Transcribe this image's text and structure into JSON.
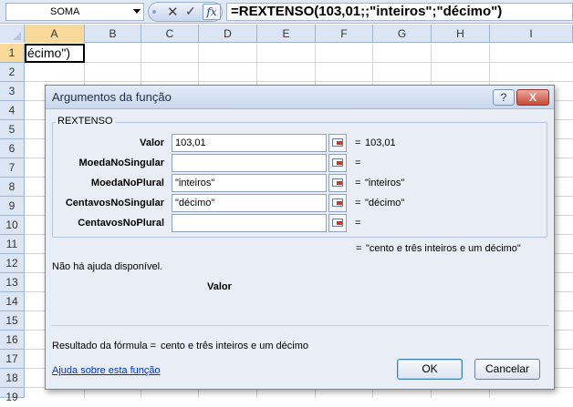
{
  "formula_bar": {
    "name_box": "SOMA",
    "cancel_symbol": "✕",
    "enter_symbol": "✓",
    "insert_function_symbol": "fx",
    "formula": "=REXTENSO(103,01;;\"inteiros\";\"décimo\")"
  },
  "grid": {
    "columns": [
      "A",
      "B",
      "C",
      "D",
      "E",
      "F",
      "G",
      "H",
      "I"
    ],
    "rows": [
      "1",
      "2",
      "3",
      "4",
      "5",
      "6",
      "7",
      "8",
      "9",
      "10",
      "11",
      "12",
      "13",
      "14",
      "15",
      "16",
      "17",
      "18",
      "19"
    ],
    "active_column": "A",
    "active_row": "1",
    "active_cell_text": "écimo\")"
  },
  "dialog": {
    "title": "Argumentos da função",
    "help_symbol": "?",
    "close_symbol": "X",
    "function_name": "REXTENSO",
    "arguments": [
      {
        "name": "Valor",
        "input": "103,01",
        "result": "103,01"
      },
      {
        "name": "MoedaNoSingular",
        "input": "",
        "result": ""
      },
      {
        "name": "MoedaNoPlural",
        "input": "\"inteiros\"",
        "result": "\"inteiros\""
      },
      {
        "name": "CentavosNoSingular",
        "input": "\"décimo\"",
        "result": "\"décimo\""
      },
      {
        "name": "CentavosNoPlural",
        "input": "",
        "result": ""
      }
    ],
    "equals_sign": "=",
    "function_result": "\"cento e três inteiros e um décimo\"",
    "no_help_text": "Não há ajuda disponível.",
    "current_argument": "Valor",
    "formula_result_label": "Resultado da fórmula =",
    "formula_result_value": "cento e três inteiros e um décimo",
    "help_link": "Ajuda sobre esta função",
    "ok_label": "OK",
    "cancel_label": "Cancelar"
  }
}
